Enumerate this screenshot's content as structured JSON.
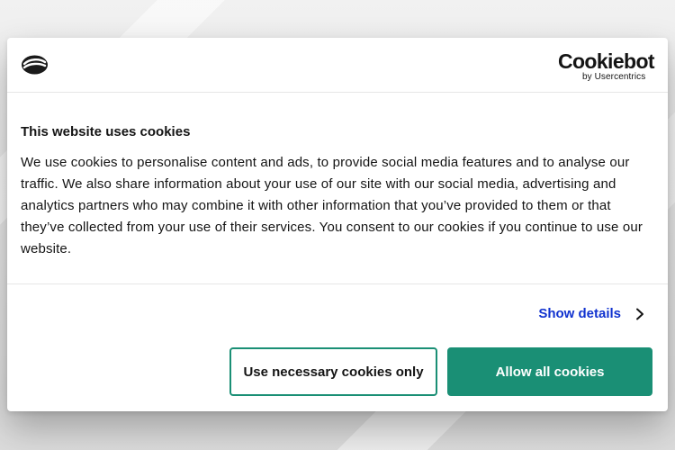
{
  "dialog": {
    "site_logo_icon": "company-logo-icon",
    "brand": {
      "name": "Cookiebot",
      "sub": "by Usercentrics"
    },
    "title": "This website uses cookies",
    "description": "We use cookies to personalise content and ads, to provide social media features and to analyse our traffic. We also share information about your use of our site with our social media, advertising and analytics partners who may combine it with other information that you’ve provided to them or that they’ve collected from your use of their services. You consent to our cookies if you continue to use our website.",
    "show_details_label": "Show details",
    "buttons": {
      "necessary_label": "Use necessary cookies only",
      "allow_all_label": "Allow all cookies"
    }
  },
  "colors": {
    "accent_green": "#1a8f75",
    "link_blue": "#1032cf",
    "text": "#141414"
  }
}
